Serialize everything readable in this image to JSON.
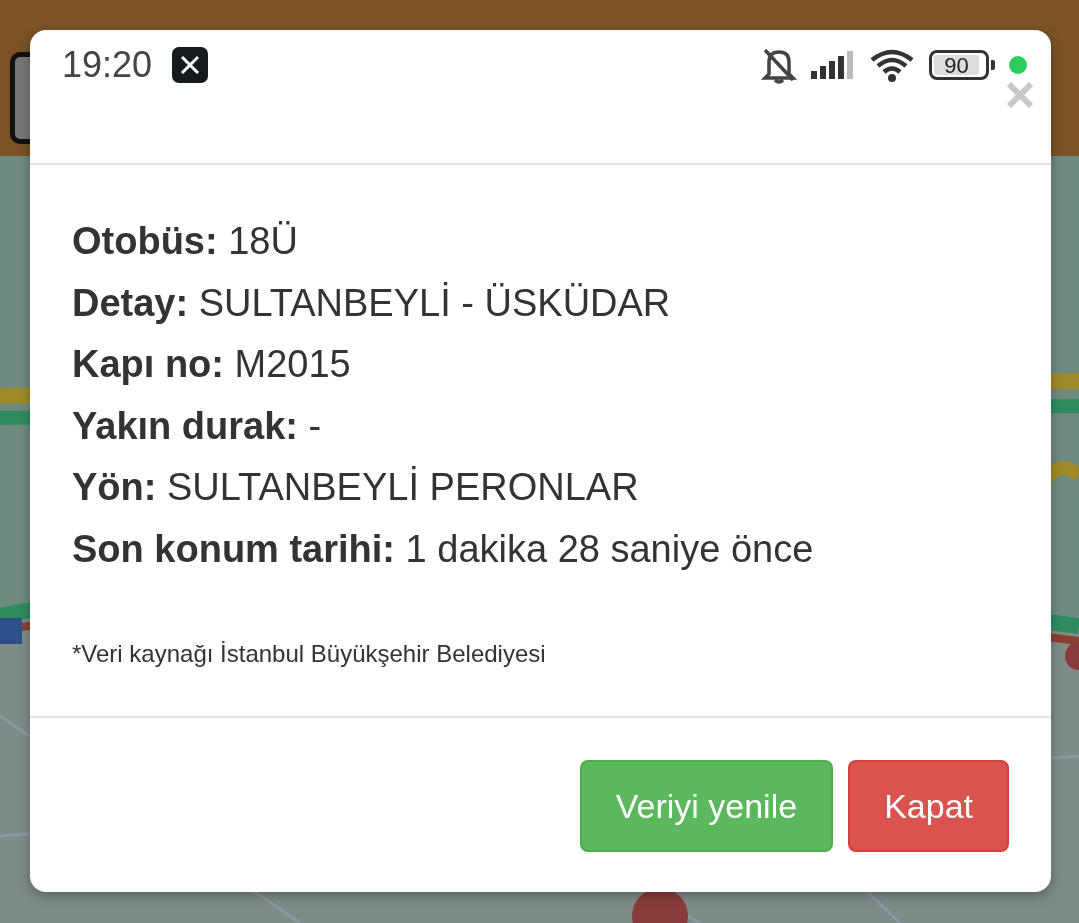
{
  "status_bar": {
    "time": "19:20",
    "battery": "90"
  },
  "dialog": {
    "fields": [
      {
        "label": "Otobüs:",
        "value": "18Ü"
      },
      {
        "label": "Detay:",
        "value": "SULTANBEYLİ - ÜSKÜDAR"
      },
      {
        "label": "Kapı no:",
        "value": "M2015"
      },
      {
        "label": "Yakın durak:",
        "value": "-"
      },
      {
        "label": "Yön:",
        "value": "SULTANBEYLİ PERONLAR"
      },
      {
        "label": "Son konum tarihi:",
        "value": "1 dakika 28 saniye önce"
      }
    ],
    "note": "*Veri kaynağı İstanbul Büyükşehir Belediyesi",
    "buttons": [
      {
        "label": "Veriyi yenile",
        "kind": "success"
      },
      {
        "label": "Kapat",
        "kind": "danger"
      }
    ]
  }
}
